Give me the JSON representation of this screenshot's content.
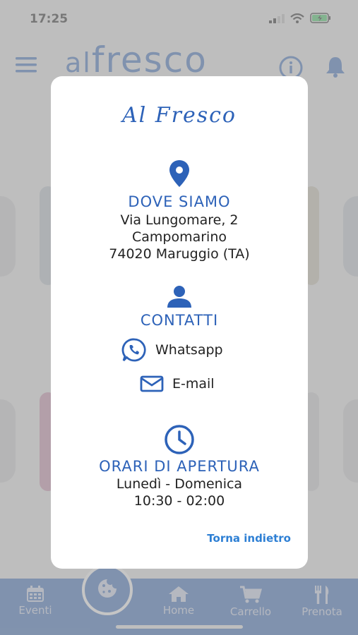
{
  "status_bar": {
    "time": "17:25"
  },
  "header": {
    "logo_prefix": "al",
    "logo_text": "fresco"
  },
  "dialog": {
    "title": "Al Fresco",
    "location": {
      "heading": "DOVE SIAMO",
      "lines": [
        "Via Lungomare, 2",
        "Campomarino",
        "74020 Maruggio (TA)"
      ]
    },
    "contacts": {
      "heading": "CONTATTI",
      "whatsapp_label": "Whatsapp",
      "email_label": "E-mail"
    },
    "hours": {
      "heading": "ORARI DI APERTURA",
      "days": "Lunedì - Domenica",
      "time": "10:30 - 02:00"
    },
    "back_label": "Torna indietro"
  },
  "bottom_nav": {
    "items": [
      {
        "label": "Eventi",
        "icon": "calendar-icon"
      },
      {
        "label": "Home",
        "icon": "home-icon"
      },
      {
        "label": "Carrello",
        "icon": "cart-icon"
      },
      {
        "label": "Prenota",
        "icon": "cutlery-icon"
      }
    ],
    "center_icon": "cookie-icon"
  },
  "colors": {
    "brand_blue": "#2d62b8",
    "link_blue": "#2d7fd4"
  }
}
